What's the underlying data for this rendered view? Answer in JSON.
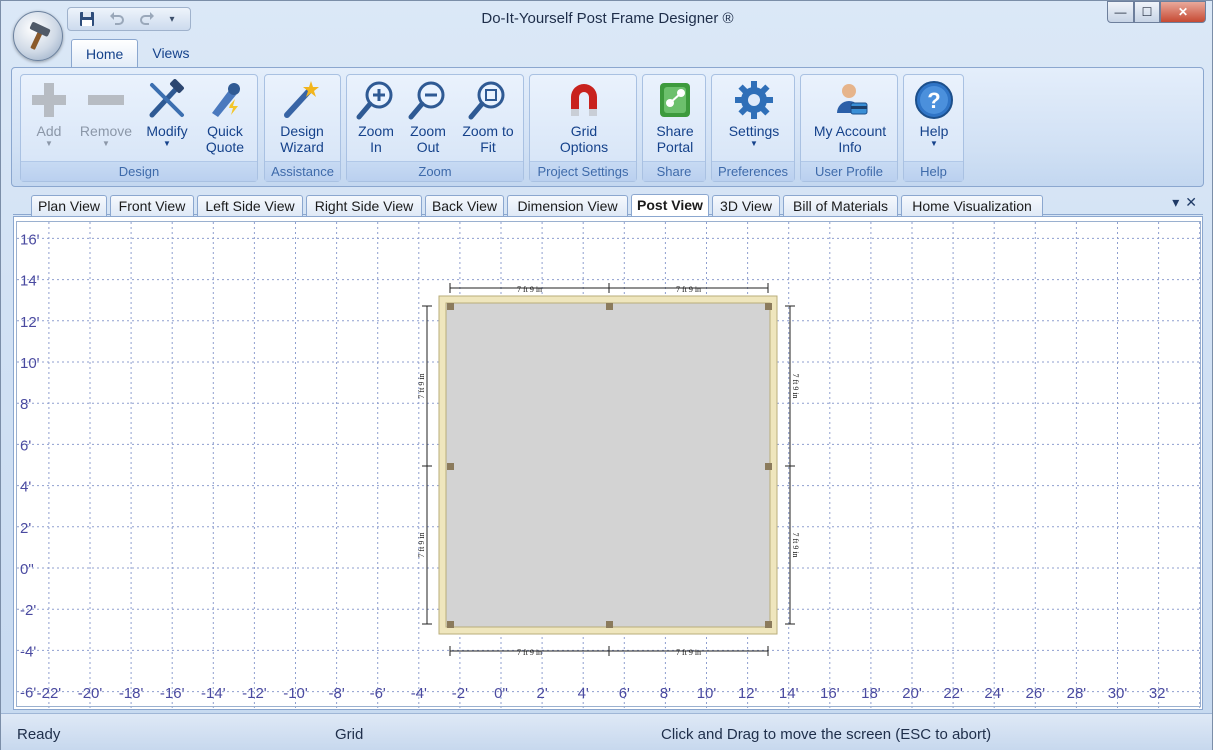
{
  "window": {
    "title": "Do-It-Yourself Post Frame Designer ®",
    "minimize_glyph": "—",
    "maximize_glyph": "☐",
    "close_glyph": "✕"
  },
  "qat": {
    "save_icon": "save-icon",
    "undo_icon": "undo-icon",
    "redo_icon": "redo-icon",
    "customize_glyph": "▾"
  },
  "ribbon_tabs": [
    {
      "label": "Home",
      "active": true
    },
    {
      "label": "Views",
      "active": false
    }
  ],
  "ribbon_groups": [
    {
      "label": "Design",
      "buttons": [
        {
          "line1": "Add",
          "line2": "",
          "arrow": "▼",
          "icon": "add-icon",
          "enabled": false
        },
        {
          "line1": "Remove",
          "line2": "",
          "arrow": "▼",
          "icon": "remove-icon",
          "enabled": false
        },
        {
          "line1": "Modify",
          "line2": "",
          "arrow": "▼",
          "icon": "modify-tools-icon",
          "enabled": true
        },
        {
          "line1": "Quick",
          "line2": "Quote",
          "arrow": "",
          "icon": "quick-quote-icon",
          "enabled": true
        }
      ]
    },
    {
      "label": "Assistance",
      "buttons": [
        {
          "line1": "Design",
          "line2": "Wizard",
          "arrow": "",
          "icon": "magic-wand-icon",
          "enabled": true
        }
      ]
    },
    {
      "label": "Zoom",
      "buttons": [
        {
          "line1": "Zoom",
          "line2": "In",
          "arrow": "",
          "icon": "zoom-in-icon",
          "enabled": true
        },
        {
          "line1": "Zoom",
          "line2": "Out",
          "arrow": "",
          "icon": "zoom-out-icon",
          "enabled": true
        },
        {
          "line1": "Zoom to",
          "line2": "Fit",
          "arrow": "",
          "icon": "zoom-fit-icon",
          "enabled": true
        }
      ]
    },
    {
      "label": "Project Settings",
      "buttons": [
        {
          "line1": "Grid",
          "line2": "Options",
          "arrow": "",
          "icon": "magnet-icon",
          "enabled": true
        }
      ]
    },
    {
      "label": "Share",
      "buttons": [
        {
          "line1": "Share",
          "line2": "Portal",
          "arrow": "",
          "icon": "share-portal-icon",
          "enabled": true
        }
      ]
    },
    {
      "label": "Preferences",
      "buttons": [
        {
          "line1": "Settings",
          "line2": "",
          "arrow": "▼",
          "icon": "gear-icon",
          "enabled": true
        }
      ]
    },
    {
      "label": "User Profile",
      "buttons": [
        {
          "line1": "My Account",
          "line2": "Info",
          "arrow": "",
          "icon": "user-account-icon",
          "enabled": true
        }
      ]
    },
    {
      "label": "Help",
      "buttons": [
        {
          "line1": "Help",
          "line2": "",
          "arrow": "▼",
          "icon": "help-icon",
          "enabled": true
        }
      ]
    }
  ],
  "view_tabs": [
    {
      "label": "Plan View"
    },
    {
      "label": "Front View"
    },
    {
      "label": "Left Side View"
    },
    {
      "label": "Right Side View"
    },
    {
      "label": "Back View"
    },
    {
      "label": "Dimension View"
    },
    {
      "label": "Post View",
      "active": true
    },
    {
      "label": "3D View"
    },
    {
      "label": "Bill of Materials"
    },
    {
      "label": "Home Visualization"
    }
  ],
  "tab_controls": {
    "dropdown_glyph": "▾",
    "close_glyph": "✕"
  },
  "plan": {
    "grid_color": "#8f9fcf",
    "label_color": "#4a4aa0",
    "wall_color": "#efe6bd",
    "floor_color": "#d3d3d3",
    "post_color": "#8b7b5c",
    "y_axis_labels": [
      "16'",
      "14'",
      "12'",
      "10'",
      "8'",
      "6'",
      "4'",
      "2'",
      "0\"",
      "-2'",
      "-4'",
      "-6'"
    ],
    "x_axis_labels": [
      "-22'",
      "-20'",
      "-18'",
      "-16'",
      "-14'",
      "-12'",
      "-10'",
      "-8'",
      "-6'",
      "-4'",
      "-2'",
      "0\"",
      "2'",
      "4'",
      "6'",
      "8'",
      "10'",
      "12'",
      "14'",
      "16'",
      "18'",
      "20'",
      "22'",
      "24'",
      "26'",
      "28'",
      "30'",
      "32'"
    ],
    "dimension_label": "7 ft 9 in"
  },
  "status": {
    "left": "Ready",
    "mid": "Grid",
    "right": "Click and Drag to move the screen  (ESC to abort)"
  }
}
